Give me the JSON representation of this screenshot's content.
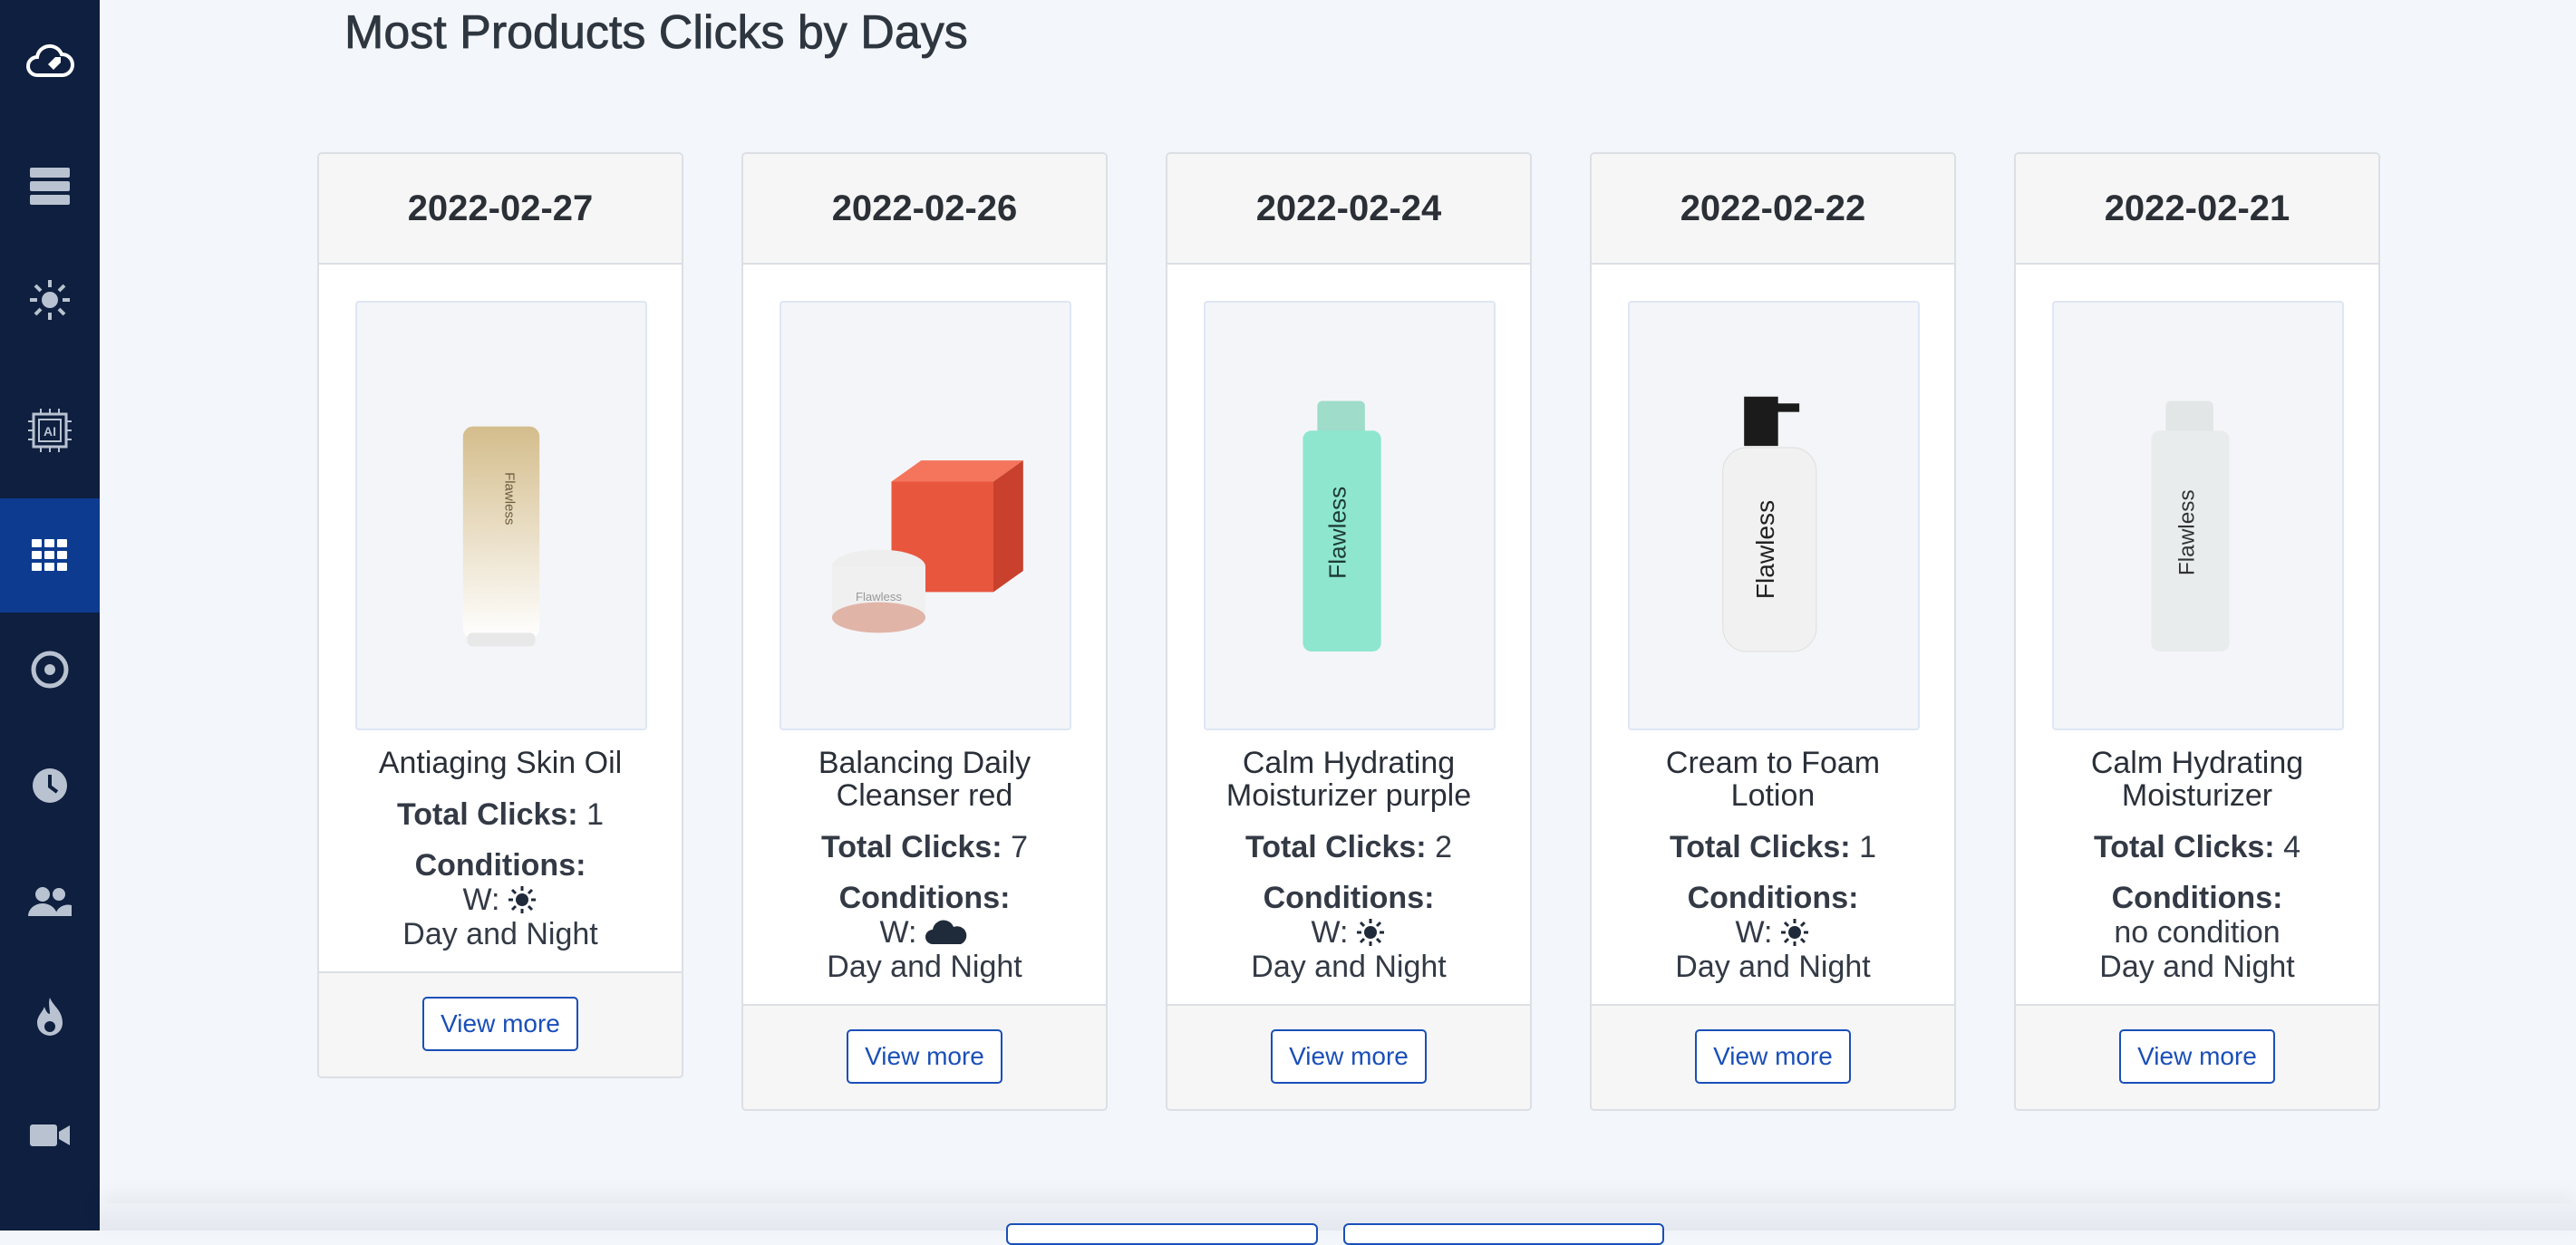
{
  "page": {
    "title": "Most Products Clicks by Days"
  },
  "sidebar": {
    "items": [
      {
        "icon": "cloud-tag-icon"
      },
      {
        "icon": "server-icon"
      },
      {
        "icon": "sun-icon"
      },
      {
        "icon": "ai-chip-icon"
      },
      {
        "icon": "grid-icon",
        "active": true
      },
      {
        "icon": "target-icon"
      },
      {
        "icon": "clock-icon"
      },
      {
        "icon": "users-icon"
      },
      {
        "icon": "fire-icon"
      },
      {
        "icon": "video-icon"
      }
    ]
  },
  "carousel": {
    "prev_icon": "chevron-left-icon",
    "next_icon": "chevron-right-icon",
    "cards": [
      {
        "date": "2022-02-27",
        "name": "Antiaging Skin Oil",
        "clicks_label": "Total Clicks:",
        "clicks": "1",
        "conditions_label": "Conditions:",
        "weather_prefix": "W:",
        "weather_icon": "sun-icon",
        "weather_text": "",
        "time": "Day and Night",
        "button": "View more",
        "product_art": "tube"
      },
      {
        "date": "2022-02-26",
        "name": "Balancing Daily Cleanser red",
        "clicks_label": "Total Clicks:",
        "clicks": "7",
        "conditions_label": "Conditions:",
        "weather_prefix": "W:",
        "weather_icon": "cloud-icon",
        "weather_text": "",
        "time": "Day and Night",
        "button": "View more",
        "product_art": "jar-box"
      },
      {
        "date": "2022-02-24",
        "name": "Calm Hydrating Moisturizer purple",
        "clicks_label": "Total Clicks:",
        "clicks": "2",
        "conditions_label": "Conditions:",
        "weather_prefix": "W:",
        "weather_icon": "sun-icon",
        "weather_text": "",
        "time": "Day and Night",
        "button": "View more",
        "product_art": "bottle-mint"
      },
      {
        "date": "2022-02-22",
        "name": "Cream to Foam Lotion",
        "clicks_label": "Total Clicks:",
        "clicks": "1",
        "conditions_label": "Conditions:",
        "weather_prefix": "W:",
        "weather_icon": "sun-icon",
        "weather_text": "",
        "time": "Day and Night",
        "button": "View more",
        "product_art": "pump"
      },
      {
        "date": "2022-02-21",
        "name": "Calm Hydrating Moisturizer",
        "clicks_label": "Total Clicks:",
        "clicks": "4",
        "conditions_label": "Conditions:",
        "weather_prefix": "",
        "weather_icon": "",
        "weather_text": "no condition",
        "time": "Day and Night",
        "button": "View more",
        "product_art": "bottle-grey"
      }
    ]
  },
  "logo_text": "Flawless",
  "colors": {
    "sidebar": "#0e1f3f",
    "sidebar_active": "#0d3b8f",
    "accent": "#1a4fb8"
  }
}
